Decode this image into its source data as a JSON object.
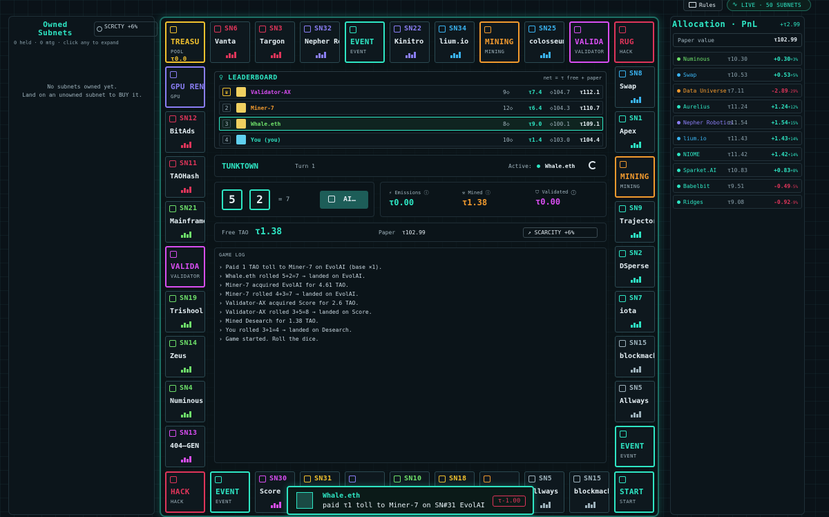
{
  "left": {
    "title": "Owned Subnets",
    "scarcity": "SCRCTY +6%",
    "subtitle": "0 held · 0 mtg · click any to expand",
    "empty_line1": "No subnets owned yet.",
    "empty_line2": "Land on an unowned subnet to BUY it."
  },
  "topbar": {
    "rules": "Rules",
    "live": "LIVE · 50 SUBNETS"
  },
  "allocation": {
    "title": "Allocation · PnL",
    "pnl": "+τ2.99",
    "paper_label": "Paper value",
    "paper_value": "τ102.99",
    "rows": [
      {
        "name": "Numinous",
        "price": "τ10.30",
        "change": "+0.30",
        "pct": "+3%",
        "color": "#6ee06a",
        "dir": "up"
      },
      {
        "name": "Swap",
        "price": "τ10.53",
        "change": "+0.53",
        "pct": "+5%",
        "color": "#3ab4f2",
        "dir": "up"
      },
      {
        "name": "Data Universe",
        "price": "τ7.11",
        "change": "-2.89",
        "pct": "-29%",
        "color": "#f29a2e",
        "dir": "down"
      },
      {
        "name": "Aurelius",
        "price": "τ11.24",
        "change": "+1.24",
        "pct": "+12%",
        "color": "#2ee6c4",
        "dir": "up"
      },
      {
        "name": "Nepher Robotics",
        "price": "τ11.54",
        "change": "+1.54",
        "pct": "+15%",
        "color": "#8a7ef5",
        "dir": "up"
      },
      {
        "name": "lium.io",
        "price": "τ11.43",
        "change": "+1.43",
        "pct": "+14%",
        "color": "#3ab4f2",
        "dir": "up"
      },
      {
        "name": "NIOME",
        "price": "τ11.42",
        "change": "+1.42",
        "pct": "+14%",
        "color": "#2ee6c4",
        "dir": "up"
      },
      {
        "name": "Sparket.AI",
        "price": "τ10.83",
        "change": "+0.83",
        "pct": "+8%",
        "color": "#2ee6c4",
        "dir": "up"
      },
      {
        "name": "Babelbit",
        "price": "τ9.51",
        "change": "-0.49",
        "pct": "-5%",
        "color": "#2ee6c4",
        "dir": "down"
      },
      {
        "name": "Ridges",
        "price": "τ9.08",
        "change": "-0.92",
        "pct": "-9%",
        "color": "#2ee6c4",
        "dir": "down"
      }
    ]
  },
  "board": {
    "top": [
      {
        "kind": "special",
        "big": "TREASU",
        "label": "POOL",
        "extra": "τ0.0",
        "color": "#f2c12e"
      },
      {
        "kind": "subnet",
        "sn": "SN6",
        "name": "Vanta",
        "color": "#e0355a"
      },
      {
        "kind": "subnet",
        "sn": "SN3",
        "name": "Targon",
        "color": "#e0355a"
      },
      {
        "kind": "subnet",
        "sn": "SN32",
        "name": "Nepher Robotics",
        "color": "#8a7ef5"
      },
      {
        "kind": "special",
        "big": "EVENT",
        "label": "EVENT",
        "color": "#2ee6c4"
      },
      {
        "kind": "subnet",
        "sn": "SN22",
        "name": "Kinitro",
        "color": "#8a7ef5"
      },
      {
        "kind": "subnet",
        "sn": "SN34",
        "name": "lium.io",
        "color": "#3ab4f2"
      },
      {
        "kind": "special",
        "big": "MINING",
        "label": "MINING",
        "color": "#f29a2e"
      },
      {
        "kind": "subnet",
        "sn": "SN25",
        "name": "colosseum",
        "color": "#3ab4f2"
      },
      {
        "kind": "special",
        "big": "VALIDA",
        "label": "VALIDATOR",
        "color": "#d94ef2"
      },
      {
        "kind": "special",
        "big": "RUG",
        "label": "HACK",
        "color": "#e0355a"
      }
    ],
    "left": [
      {
        "kind": "special",
        "big": "GPU RENTAL",
        "label": "GPU",
        "color": "#8a7ef5"
      },
      {
        "kind": "subnet",
        "sn": "SN12",
        "name": "BitAds",
        "color": "#e0355a"
      },
      {
        "kind": "subnet",
        "sn": "SN11",
        "name": "TAOHash",
        "color": "#e0355a"
      },
      {
        "kind": "subnet",
        "sn": "SN21",
        "name": "Mainframe",
        "color": "#6ee06a"
      },
      {
        "kind": "special",
        "big": "VALIDA",
        "label": "VALIDATOR",
        "color": "#d94ef2"
      },
      {
        "kind": "subnet",
        "sn": "SN19",
        "name": "Trishool",
        "color": "#6ee06a"
      },
      {
        "kind": "subnet",
        "sn": "SN14",
        "name": "Zeus",
        "color": "#6ee06a"
      },
      {
        "kind": "subnet",
        "sn": "SN4",
        "name": "Numinous",
        "color": "#6ee06a"
      },
      {
        "kind": "subnet",
        "sn": "SN13",
        "name": "404—GEN",
        "color": "#d94ef2"
      }
    ],
    "right": [
      {
        "kind": "subnet",
        "sn": "SN8",
        "name": "Swap",
        "color": "#3ab4f2"
      },
      {
        "kind": "subnet",
        "sn": "SN1",
        "name": "Apex",
        "color": "#2ee6c4"
      },
      {
        "kind": "special",
        "big": "MINING",
        "label": "MINING",
        "color": "#f29a2e"
      },
      {
        "kind": "subnet",
        "sn": "SN9",
        "name": "Trajectory",
        "color": "#2ee6c4"
      },
      {
        "kind": "subnet",
        "sn": "SN2",
        "name": "DSperse",
        "color": "#2ee6c4"
      },
      {
        "kind": "subnet",
        "sn": "SN7",
        "name": "iota",
        "color": "#2ee6c4"
      },
      {
        "kind": "subnet",
        "sn": "SN15",
        "name": "blockmachine",
        "color": "#9fb3bd"
      },
      {
        "kind": "subnet",
        "sn": "SN5",
        "name": "Allways",
        "color": "#9fb3bd"
      },
      {
        "kind": "special",
        "big": "EVENT",
        "label": "EVENT",
        "color": "#2ee6c4"
      }
    ],
    "bottom": [
      {
        "kind": "special",
        "big": "HACK",
        "label": "HACK",
        "color": "#e0355a"
      },
      {
        "kind": "special",
        "big": "EVENT",
        "label": "EVENT",
        "color": "#2ee6c4"
      },
      {
        "kind": "subnet",
        "sn": "SN30",
        "name": "Score",
        "color": "#d94ef2"
      },
      {
        "kind": "subnet",
        "sn": "SN31",
        "name": "",
        "color": "#f2c12e"
      },
      {
        "kind": "subnet",
        "sn": "",
        "name": "",
        "color": "#8a7ef5"
      },
      {
        "kind": "subnet",
        "sn": "SN10",
        "name": "",
        "color": "#6ee06a"
      },
      {
        "kind": "subnet",
        "sn": "SN18",
        "name": "",
        "color": "#f2c12e"
      },
      {
        "kind": "subnet",
        "sn": "",
        "name": "",
        "color": "#f29a2e"
      },
      {
        "kind": "subnet",
        "sn": "SN5",
        "name": "Allways",
        "color": "#9fb3bd"
      },
      {
        "kind": "subnet",
        "sn": "SN15",
        "name": "blockmachine",
        "color": "#9fb3bd"
      },
      {
        "kind": "special",
        "big": "START",
        "label": "START",
        "color": "#2ee6c4"
      }
    ]
  },
  "leaderboard": {
    "title": "LEADERBOARD",
    "note": "net = τ free + paper",
    "rows": [
      {
        "rank": "♛",
        "name": "Validator-AX",
        "color": "#d94ef2",
        "subnets": "9◇",
        "tao": "τ7.4",
        "paper": "◇104.7",
        "total": "τ112.1",
        "avatar": "#f0d060"
      },
      {
        "rank": "2",
        "name": "Miner-7",
        "color": "#f29a2e",
        "subnets": "12◇",
        "tao": "τ6.4",
        "paper": "◇104.3",
        "total": "τ110.7",
        "avatar": "#f0d060"
      },
      {
        "rank": "3",
        "name": "Whale.eth",
        "color": "#6ee06a",
        "subnets": "8◇",
        "tao": "τ9.0",
        "paper": "◇100.1",
        "total": "τ109.1",
        "avatar": "#f0d060"
      },
      {
        "rank": "4",
        "name": "You (you)",
        "color": "#2ee6c4",
        "subnets": "10◇",
        "tao": "τ1.4",
        "paper": "◇103.0",
        "total": "τ104.4",
        "avatar": "#60d0f0"
      }
    ]
  },
  "turn": {
    "town": "TUNKTOWN",
    "turn": "Turn 1",
    "active_label": "Active:",
    "active": "Whale.eth"
  },
  "dice": {
    "d1": "5",
    "d2": "2",
    "sum": "= 7",
    "ai": "AI…"
  },
  "stats": {
    "emissions_label": "Emissions",
    "emissions": "τ0.00",
    "mined_label": "Mined",
    "mined": "τ1.38",
    "validated_label": "Validated",
    "validated": "τ0.00"
  },
  "wallet": {
    "free_label": "Free TAO",
    "free": "τ1.38",
    "paper_label": "Paper",
    "paper": "τ102.99",
    "scarcity": "↗ SCARCITY +6%"
  },
  "log": {
    "title": "GAME LOG",
    "lines": [
      "› Paid 1 TAO toll to Miner-7 on EvolAI (base ×1).",
      "› Whale.eth rolled 5+2=7 → landed on EvolAI.",
      "› Miner-7 acquired EvolAI for 4.61 TAO.",
      "› Miner-7 rolled 4+3=7 → landed on EvolAI.",
      "› Validator-AX acquired Score for 2.6 TAO.",
      "› Validator-AX rolled 3+5=8 → landed on Score.",
      "› Mined Desearch for 1.38 TAO.",
      "› You rolled 3+1=4 → landed on Desearch.",
      "› Game started. Roll the dice."
    ]
  },
  "toast": {
    "name": "Whale.eth",
    "message": "paid τ1 toll to Miner-7 on SN#31 EvolAI",
    "badge": "τ-1.00"
  }
}
